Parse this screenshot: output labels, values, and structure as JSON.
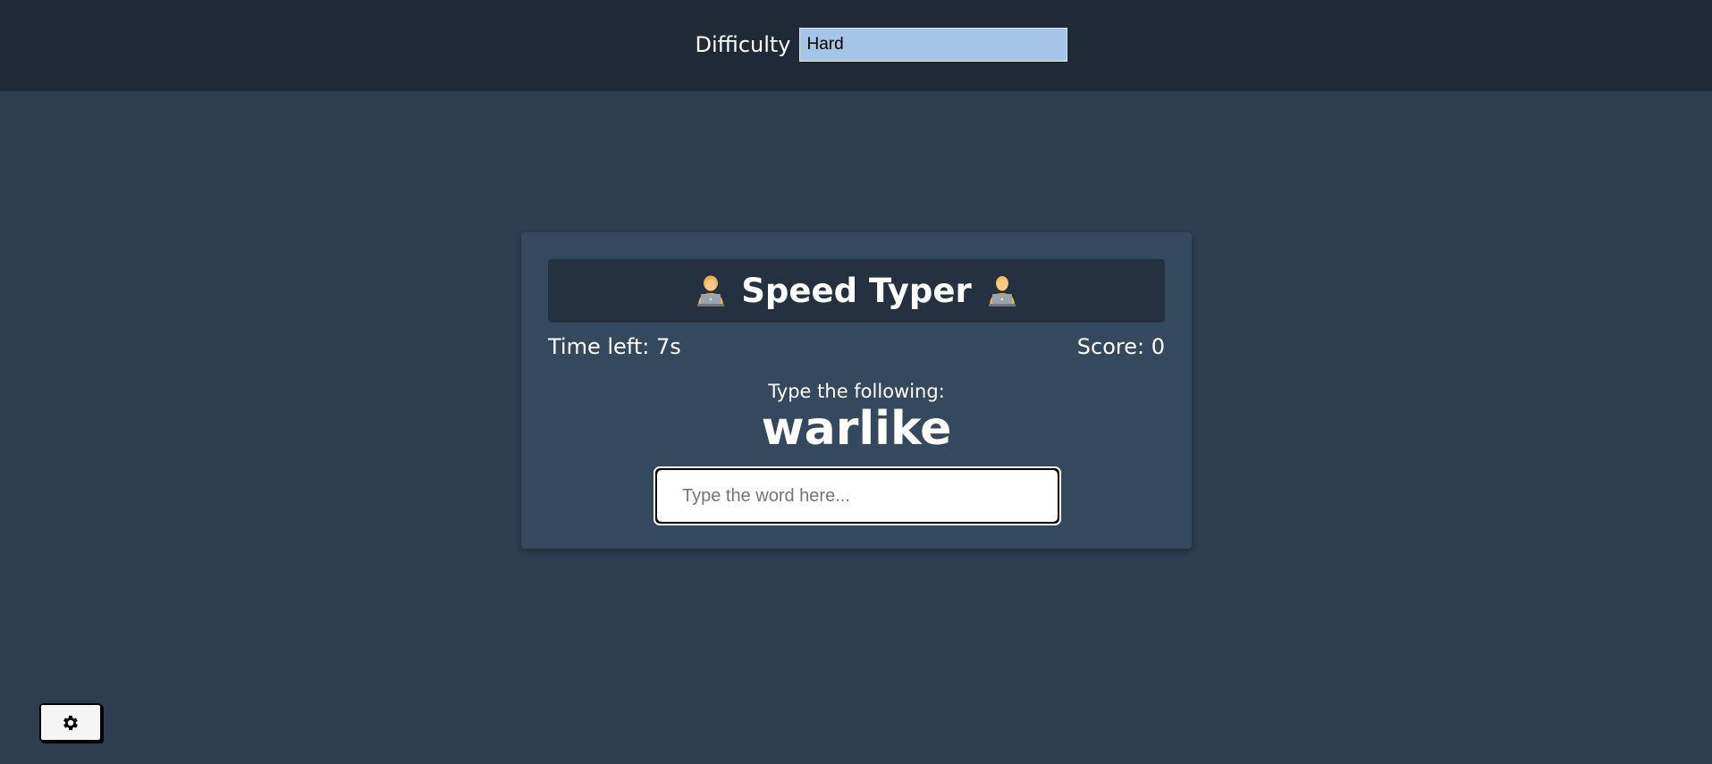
{
  "header": {
    "difficulty_label": "Difficulty",
    "difficulty_value": "Hard"
  },
  "game": {
    "title": "Speed Typer",
    "left_icon": "person-at-laptop-icon",
    "right_icon": "person-at-laptop-icon",
    "time_left": "Time left: 7s",
    "score": "Score: 0",
    "prompt": "Type the following:",
    "word": "warlike",
    "input_value": "",
    "input_placeholder": "Type the word here..."
  },
  "settings": {
    "icon": "gear-icon"
  },
  "colors": {
    "page_bg": "#2c3e50",
    "header_bg": "#1f2a38",
    "card_bg": "#34495e",
    "title_bg": "#233140",
    "select_bg": "#a6c4e6"
  }
}
